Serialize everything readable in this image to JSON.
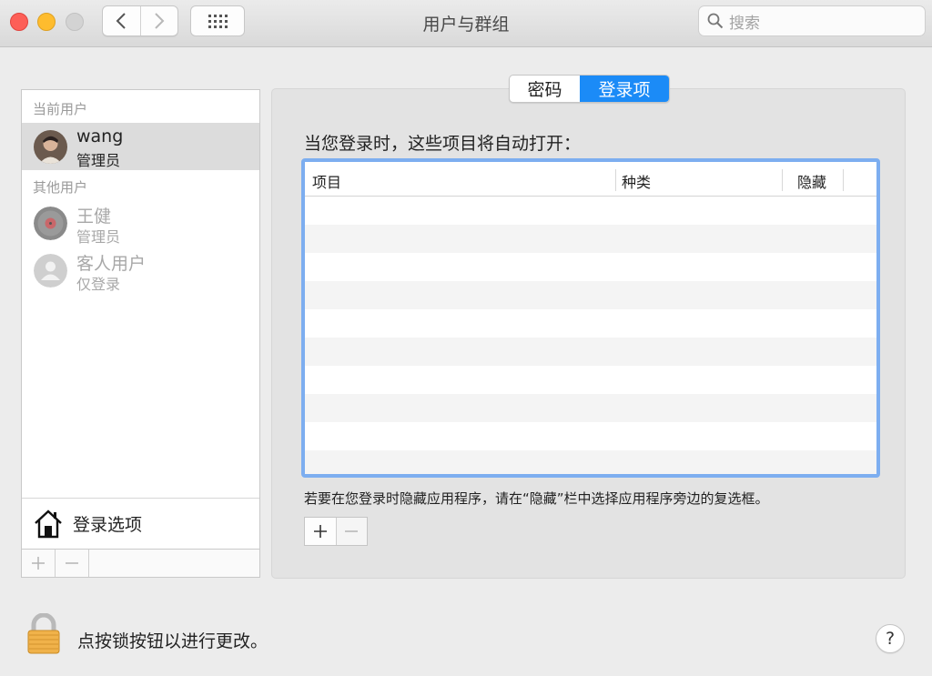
{
  "window": {
    "title": "用户与群组"
  },
  "toolbar": {
    "back_icon": "chevron-left-icon",
    "forward_icon": "chevron-right-icon",
    "grid_icon": "grid-icon",
    "search_placeholder": "搜索"
  },
  "users": {
    "current_header": "当前用户",
    "current": {
      "name": "wang",
      "role": "管理员"
    },
    "others_header": "其他用户",
    "others": [
      {
        "name": "王健",
        "role": "管理员"
      },
      {
        "name": "客人用户",
        "role": "仅登录"
      }
    ],
    "login_options_label": "登录选项"
  },
  "tabs": [
    {
      "label": "密码",
      "selected": false
    },
    {
      "label": "登录项",
      "selected": true
    }
  ],
  "login_items": {
    "prompt": "当您登录时，这些项目将自动打开：",
    "columns": [
      "项目",
      "种类",
      "隐藏"
    ],
    "rows": [],
    "hint": "若要在您登录时隐藏应用程序，请在“隐藏”栏中选择应用程序旁边的复选框。"
  },
  "footer": {
    "lock_text": "点按锁按钮以进行更改。",
    "help_label": "?"
  },
  "colors": {
    "accent": "#1b8bf7",
    "focus_ring": "#7daef0",
    "close": "#fd5f57",
    "minimize": "#febc2e"
  }
}
